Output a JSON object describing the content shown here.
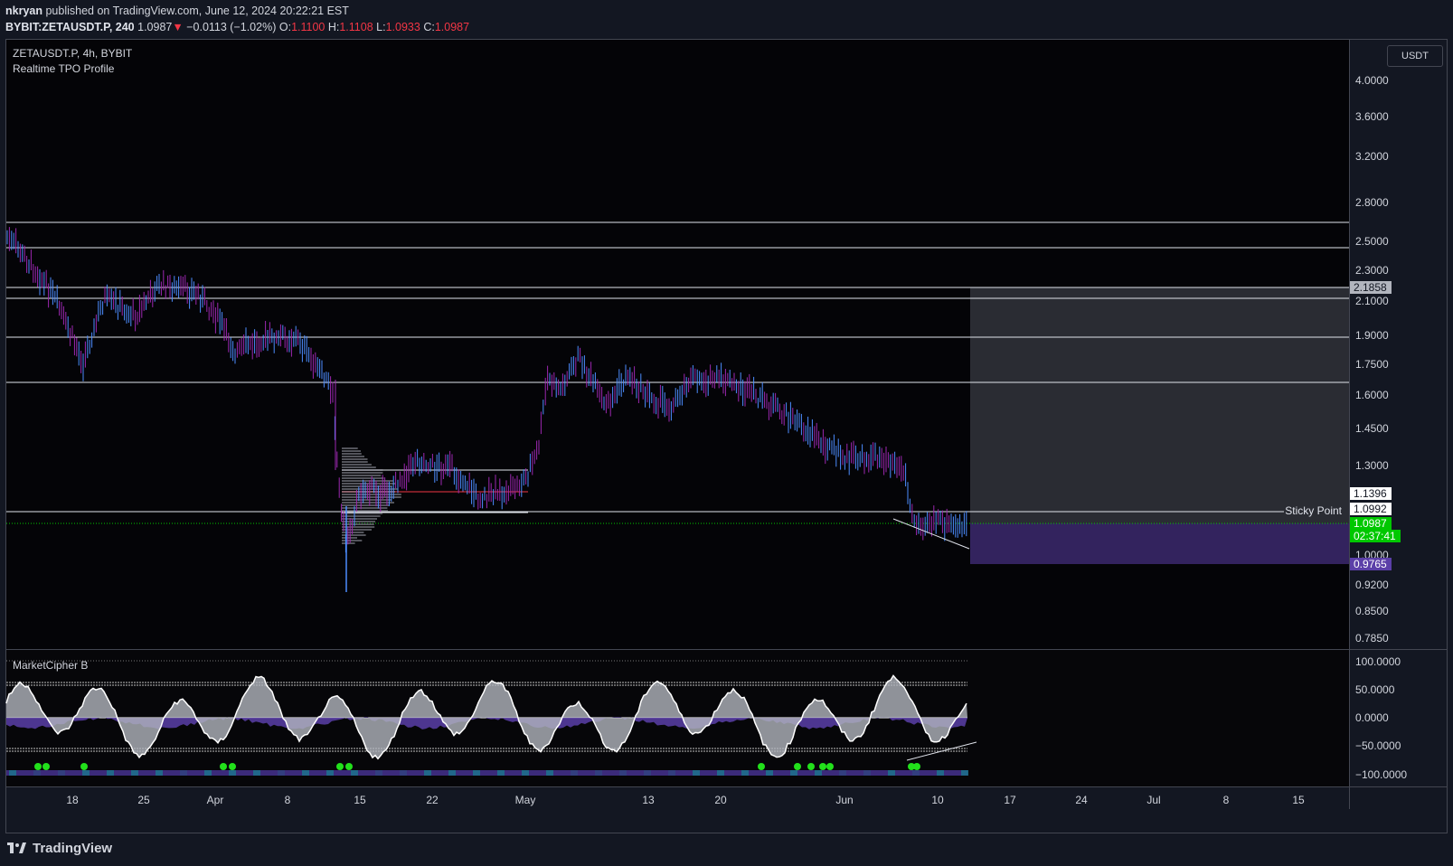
{
  "header": {
    "author": "nkryan",
    "published_text": " published on TradingView.com, June 12, 2024 20:22:21 EST",
    "symbol": "BYBIT:ZETAUSDT.P, 240",
    "last": "1.0987",
    "arrow": "▼",
    "change": "−0.0113 (−1.02%)",
    "o_label": "O:",
    "o_value": "1.1100",
    "h_label": "H:",
    "h_value": "1.1108",
    "l_label": "L:",
    "l_value": "1.0933",
    "c_label": "C:",
    "c_value": "1.0987"
  },
  "legend": {
    "title": "ZETAUSDT.P, 4h, BYBIT",
    "indicator": "Realtime TPO Profile",
    "oscillator": "MarketCipher B"
  },
  "price_axis": {
    "currency": "USDT",
    "ticks": [
      "4.0000",
      "3.6000",
      "3.2000",
      "2.8000",
      "2.5000",
      "2.3000",
      "2.1000",
      "1.9000",
      "1.7500",
      "1.6000",
      "1.4500",
      "1.3000",
      "1.0000",
      "0.9200",
      "0.8500",
      "0.7850"
    ],
    "labels": [
      {
        "value": "2.1858",
        "bg": "#b2b5be",
        "fg": "#131722"
      },
      {
        "value": "1.1396",
        "bg": "#ffffff",
        "fg": "#131722"
      },
      {
        "value": "1.0992",
        "bg": "#ffffff",
        "fg": "#131722"
      },
      {
        "value": "1.0987",
        "bg": "#00c800",
        "fg": "#ffffff"
      },
      {
        "value": "02:37:41",
        "bg": "#00c800",
        "fg": "#ffffff"
      },
      {
        "value": "0.9765",
        "bg": "#5b3fa8",
        "fg": "#ffffff"
      }
    ]
  },
  "osc_axis": {
    "ticks": [
      "100.0000",
      "50.0000",
      "0.0000",
      "−50.0000",
      "−100.0000"
    ]
  },
  "time_axis": {
    "ticks": [
      "18",
      "25",
      "Apr",
      "8",
      "15",
      "22",
      "May",
      "13",
      "20",
      "Jun",
      "10",
      "17",
      "24",
      "Jul",
      "8",
      "15"
    ]
  },
  "annotations": {
    "sticky_point": "Sticky Point"
  },
  "footer": {
    "brand": "TradingView"
  },
  "colors": {
    "up": "#4c8dff",
    "down": "#9c27b0",
    "last_price": "#00c800",
    "zone": "#3b2a7a",
    "bg": "#131722"
  }
}
